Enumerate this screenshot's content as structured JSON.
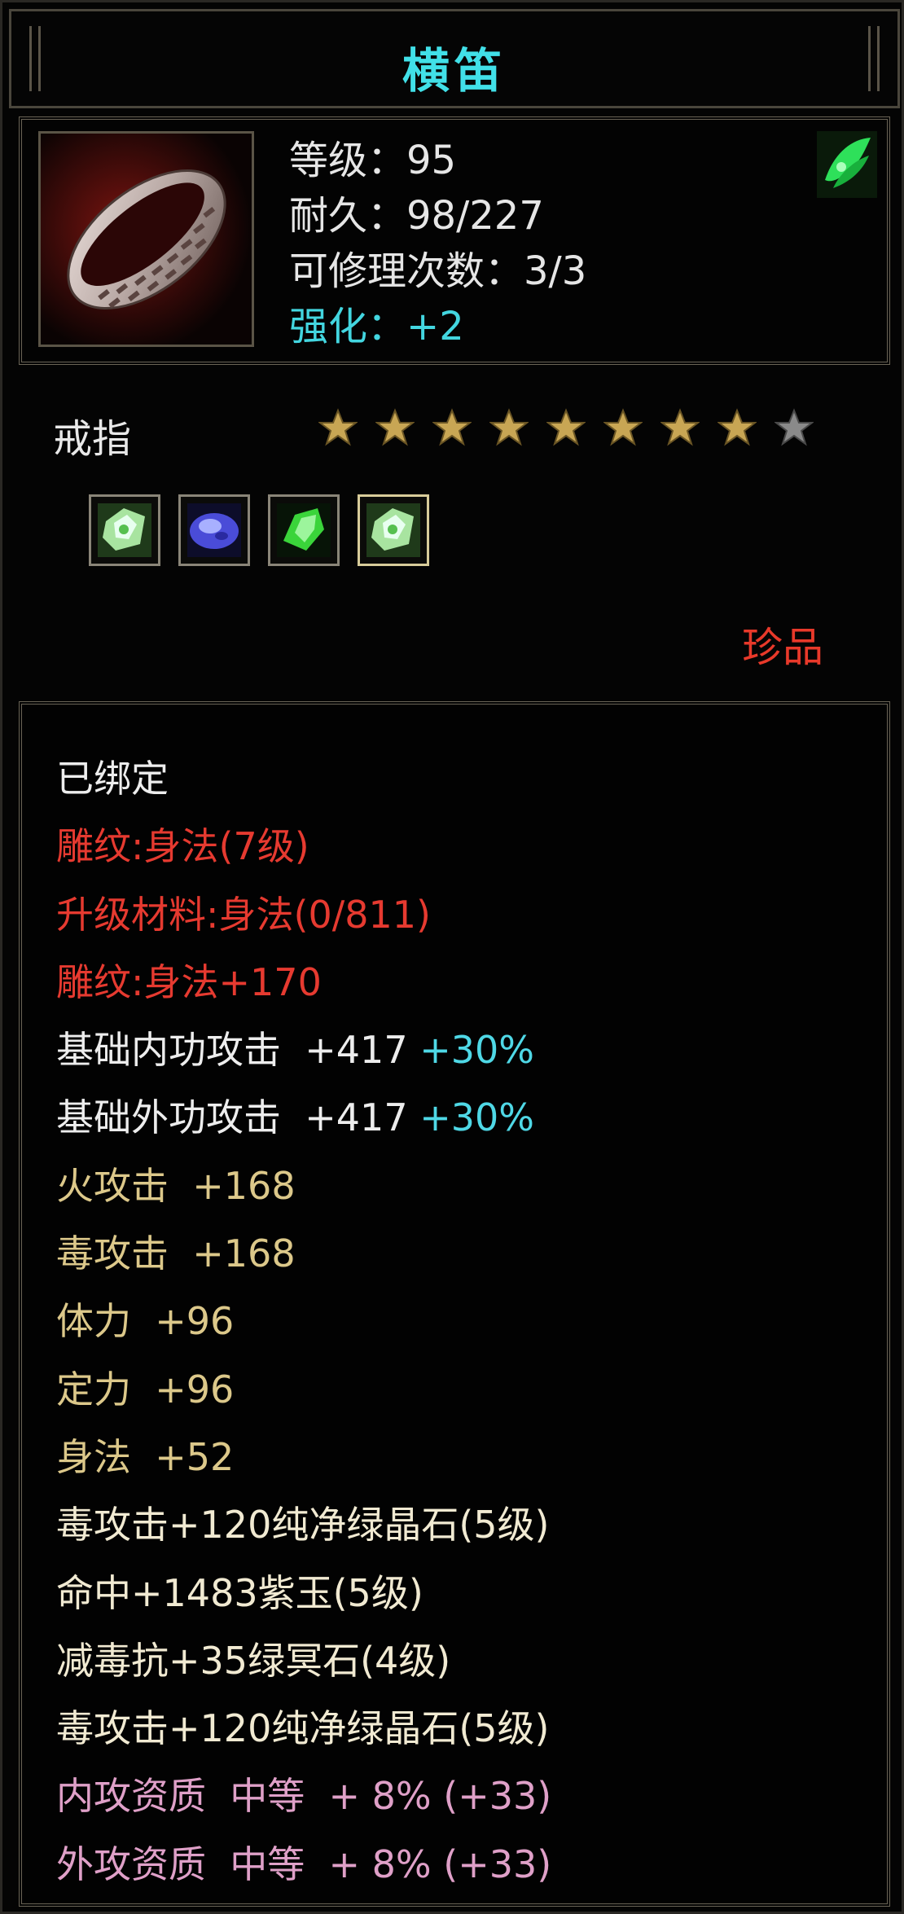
{
  "item": {
    "name": "横笛",
    "level_line": "等级：95",
    "durability_line": "耐久：98/227",
    "repair_line": "可修理次数：3/3",
    "enhance_line": "强化：+2",
    "type": "戒指",
    "stars_filled": 8,
    "stars_total": 9,
    "rarity": "珍品"
  },
  "gems": [
    {
      "icon": "green-crystal-gem-icon"
    },
    {
      "icon": "purple-jade-gem-icon"
    },
    {
      "icon": "green-leaf-gem-icon"
    },
    {
      "icon": "green-crystal-gem-icon",
      "selected": true
    }
  ],
  "attributes": {
    "bound": "已绑定",
    "engrave": "雕纹:身法(7级)",
    "upgrade_material": "升级材料:身法(0/811)",
    "engrave_bonus": "雕纹:身法+170",
    "inner_attack": {
      "label": "基础内功攻击  +417 ",
      "pct": "+30%"
    },
    "outer_attack": {
      "label": "基础外功攻击  +417 ",
      "pct": "+30%"
    },
    "fire_attack": "火攻击  +168",
    "poison_attack": "毒攻击  +168",
    "stamina": "体力  +96",
    "focus": "定力  +96",
    "agility": "身法  +52",
    "socket_1": "毒攻击+120纯净绿晶石(5级)",
    "socket_2": "命中+1483紫玉(5级)",
    "socket_3": "减毒抗+35绿冥石(4级)",
    "socket_4": "毒攻击+120纯净绿晶石(5级)",
    "inner_quality": "内攻资质  中等  + 8% (+33)",
    "outer_quality": "外攻资质  中等  + 8% (+33)"
  },
  "colors": {
    "title": "#41e0e8",
    "red": "#e63a30",
    "gold": "#dcc88a",
    "pink": "#dfa0c8",
    "cyan": "#4fd8e6"
  }
}
